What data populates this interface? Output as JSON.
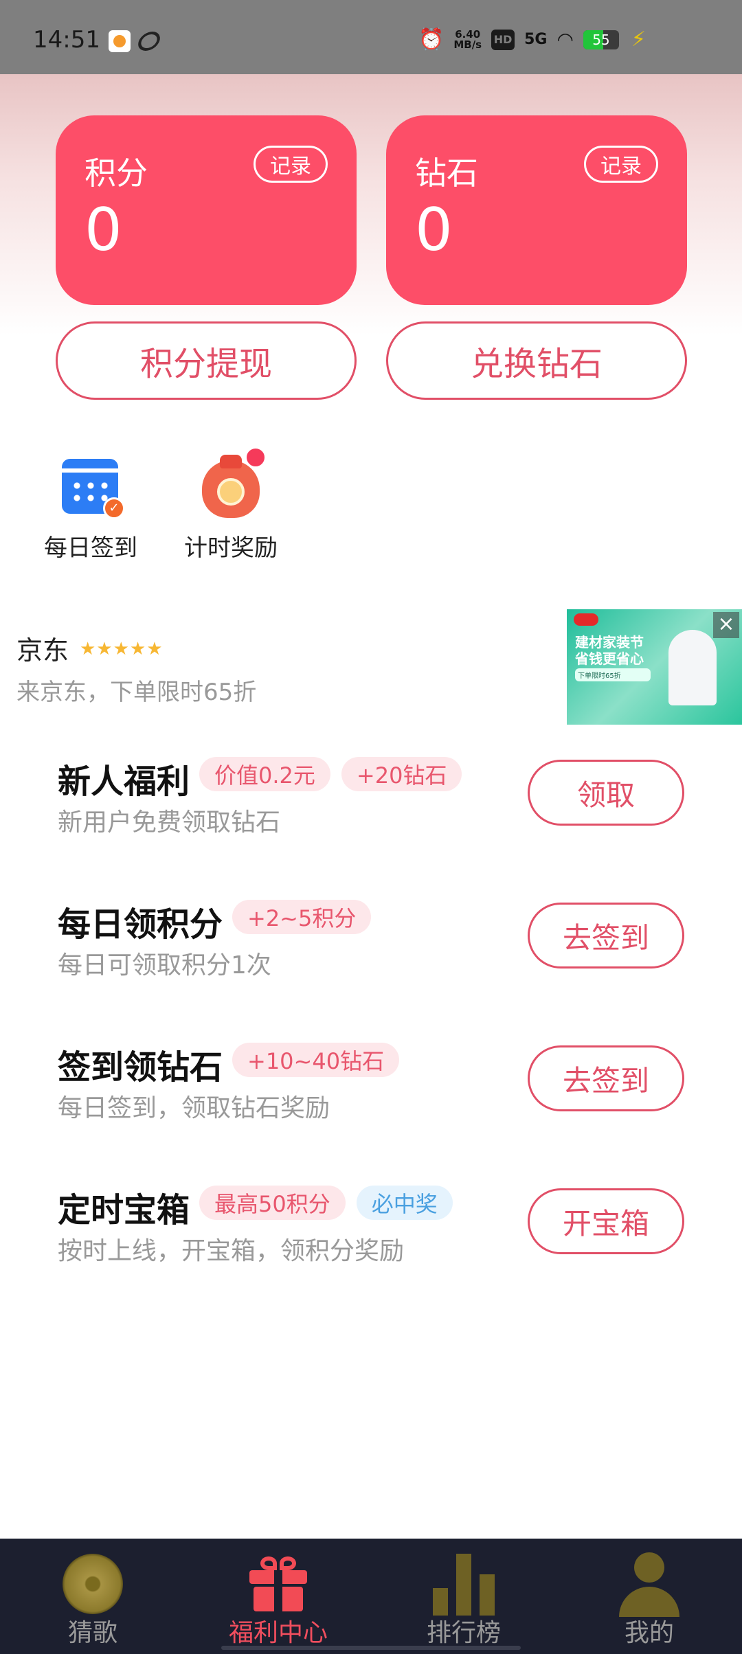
{
  "status_bar": {
    "time": "14:51",
    "speed": "6.40\nMB/s",
    "hd": "HD",
    "network": "5G",
    "battery": "55"
  },
  "cards": {
    "points": {
      "title": "积分",
      "value": "0",
      "record_label": "记录"
    },
    "diamonds": {
      "title": "钻石",
      "value": "0",
      "record_label": "记录"
    }
  },
  "actions": {
    "withdraw_label": "积分提现",
    "exchange_label": "兑换钻石"
  },
  "quick_links": [
    {
      "label": "每日签到",
      "icon": "calendar-check-icon"
    },
    {
      "label": "计时奖励",
      "icon": "money-bag-clock-icon"
    }
  ],
  "ad": {
    "title": "京东",
    "stars": "★★★★★",
    "description": "来京东，下单限时65折",
    "image_text": "建材家装节 省钱更省心",
    "image_subtext": "下单限时65折"
  },
  "tasks": [
    {
      "title": "新人福利",
      "tags": [
        {
          "text": "价值0.2元",
          "style": "red"
        },
        {
          "text": "+20钻石",
          "style": "red"
        }
      ],
      "description": "新用户免费领取钻石",
      "button": "领取"
    },
    {
      "title": "每日领积分",
      "tags": [
        {
          "text": "+2~5积分",
          "style": "red"
        }
      ],
      "description": "每日可领取积分1次",
      "button": "去签到"
    },
    {
      "title": "签到领钻石",
      "tags": [
        {
          "text": "+10~40钻石",
          "style": "red"
        }
      ],
      "description": "每日签到，领取钻石奖励",
      "button": "去签到"
    },
    {
      "title": "定时宝箱",
      "tags": [
        {
          "text": "最高50积分",
          "style": "red"
        },
        {
          "text": "必中奖",
          "style": "blue"
        }
      ],
      "description": "按时上线，开宝箱，领积分奖励",
      "button": "开宝箱"
    }
  ],
  "bottom_nav": [
    {
      "label": "猜歌",
      "icon": "disc-icon",
      "active": false
    },
    {
      "label": "福利中心",
      "icon": "gift-icon",
      "active": true
    },
    {
      "label": "排行榜",
      "icon": "bar-chart-icon",
      "active": false
    },
    {
      "label": "我的",
      "icon": "person-icon",
      "active": false
    }
  ],
  "colors": {
    "primary": "#fd4e68",
    "accent_outline": "#e14f67",
    "nav_bg": "#1c1f2f",
    "nav_active": "#f04e5e"
  }
}
